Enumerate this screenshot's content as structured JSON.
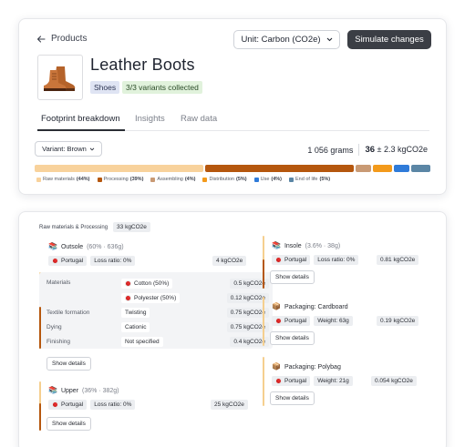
{
  "header": {
    "back_label": "Products",
    "unit_label": "Unit: Carbon (CO2e)",
    "simulate_label": "Simulate changes"
  },
  "product": {
    "title": "Leather Boots",
    "category": "Shoes",
    "variants_status": "3/3 variants collected"
  },
  "tabs": [
    {
      "label": "Footprint breakdown",
      "active": true
    },
    {
      "label": "Insights",
      "active": false
    },
    {
      "label": "Raw data",
      "active": false
    }
  ],
  "variant": {
    "label": "Variant: Brown"
  },
  "totals": {
    "grams": "1 056",
    "grams_unit": "grams",
    "co2_value": "36",
    "co2_error": "± 2.3 kgCO2e"
  },
  "breakdown": [
    {
      "name": "Raw materials",
      "pct_label": "(44%)",
      "fraction": 0.44,
      "color": "#f8d29c"
    },
    {
      "name": "Processing",
      "pct_label": "(39%)",
      "fraction": 0.39,
      "color": "#b5570e"
    },
    {
      "name": "Assembling",
      "pct_label": "(4%)",
      "fraction": 0.04,
      "color": "#c99a74"
    },
    {
      "name": "Distribution",
      "pct_label": "(5%)",
      "fraction": 0.05,
      "color": "#f39a1b"
    },
    {
      "name": "Use",
      "pct_label": "(4%)",
      "fraction": 0.04,
      "color": "#2f7bd9"
    },
    {
      "name": "End of life",
      "pct_label": "(5%)",
      "fraction": 0.05,
      "color": "#5b86a5"
    }
  ],
  "detail": {
    "header_label": "Raw materials & Processing",
    "header_value": "33 kgCO2e",
    "outsole": {
      "title": "Outsole",
      "meta": "(60% · 636g)",
      "country": "Portugal",
      "loss": "Loss ratio: 0%",
      "value": "4 kgCO2e",
      "materials_label": "Materials",
      "materials": [
        {
          "name": "Cotton (50%)",
          "value": "0.5 kgCO2e"
        },
        {
          "name": "Polyester (50%)",
          "value": "0.12 kgCO2e"
        }
      ],
      "processes": [
        {
          "label": "Textile formation",
          "value_label": "Twisting",
          "value": "0.75 kgCO2e"
        },
        {
          "label": "Dying",
          "value_label": "Cationic",
          "value": "0.75 kgCO2e"
        },
        {
          "label": "Finishing",
          "value_label": "Not specified",
          "value": "0.4 kgCO2e"
        }
      ],
      "details_label": "Show details"
    },
    "upper": {
      "title": "Upper",
      "meta": "(36% · 382g)",
      "country": "Portugal",
      "loss": "Loss ratio: 0%",
      "value": "25 kgCO2e",
      "details_label": "Show details"
    },
    "insole": {
      "title": "Insole",
      "meta": "(3.6% · 38g)",
      "country": "Portugal",
      "loss": "Loss ratio: 0%",
      "value": "0.81 kgCO2e",
      "details_label": "Show details"
    },
    "cardboard": {
      "title": "Packaging: Cardboard",
      "country": "Portugal",
      "weight": "Weight: 63g",
      "value": "0.19 kgCO2e",
      "details_label": "Show details"
    },
    "polybag": {
      "title": "Packaging: Polybag",
      "country": "Portugal",
      "weight": "Weight: 21g",
      "value": "0.054 kgCO2e",
      "details_label": "Show details"
    }
  }
}
